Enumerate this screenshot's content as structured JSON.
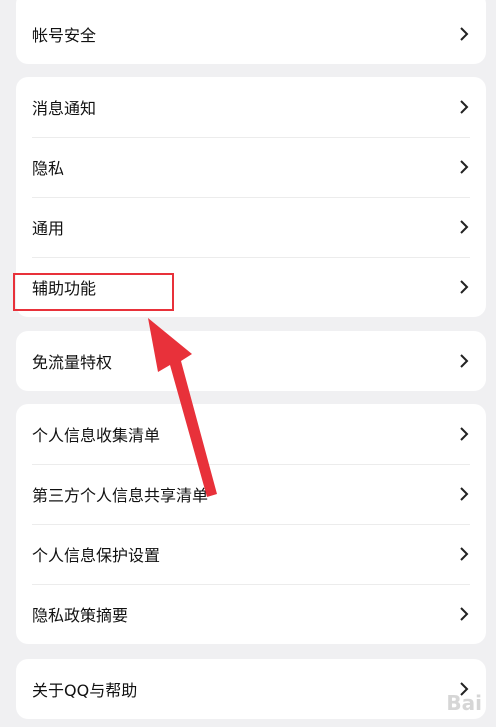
{
  "groups": [
    {
      "rows": [
        {
          "label": "帐号安全"
        }
      ]
    },
    {
      "rows": [
        {
          "label": "消息通知"
        },
        {
          "label": "隐私"
        },
        {
          "label": "通用"
        },
        {
          "label": "辅助功能"
        }
      ]
    },
    {
      "rows": [
        {
          "label": "免流量特权"
        }
      ]
    },
    {
      "rows": [
        {
          "label": "个人信息收集清单"
        },
        {
          "label": "第三方个人信息共享清单"
        },
        {
          "label": "个人信息保护设置"
        },
        {
          "label": "隐私政策摘要"
        }
      ]
    },
    {
      "rows": [
        {
          "label": "关于QQ与帮助"
        }
      ]
    }
  ],
  "annotation": {
    "highlight_target": "辅助功能",
    "color": "#e8313a"
  },
  "watermark": "Bai"
}
